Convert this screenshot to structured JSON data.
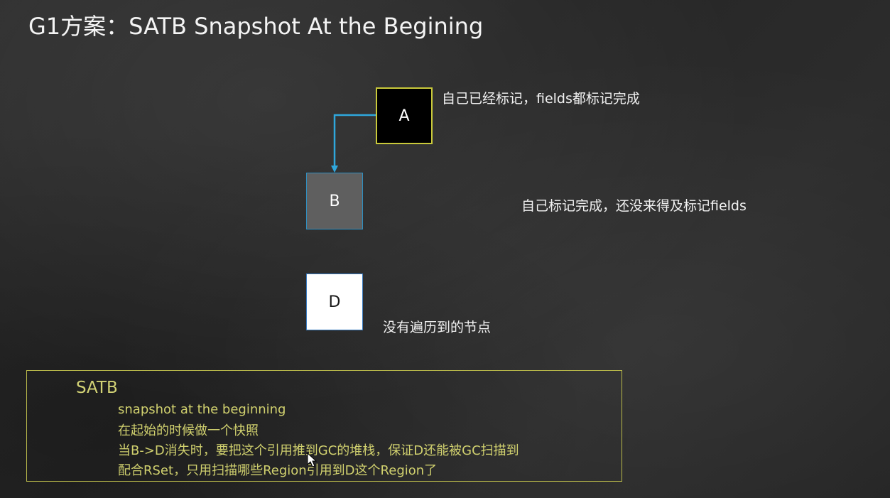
{
  "slide": {
    "title": "G1方案：SATB Snapshot At the Begining"
  },
  "nodes": {
    "a": {
      "letter": "A",
      "label": "自己已经标记，fields都标记完成"
    },
    "b": {
      "letter": "B",
      "label": "自己标记完成，还没来得及标记fields"
    },
    "d": {
      "letter": "D",
      "label": "没有遍历到的节点"
    }
  },
  "satb_box": {
    "heading": "SATB",
    "lines": [
      "snapshot at the beginning",
      "在起始的时候做一个快照",
      "当B->D消失时，要把这个引用推到GC的堆栈，保证D还能被GC扫描到",
      "配合RSet，只用扫描哪些Region引用到D这个Region了"
    ]
  },
  "colors": {
    "background": "#2b2b2b",
    "node_a_fill": "#000000",
    "node_a_border": "#c9c93a",
    "node_b_fill": "#5f5f5f",
    "node_d_fill": "#ffffff",
    "arrow": "#2fa7dc",
    "satb_text": "#d0d06e",
    "satb_border": "#b9b94a"
  },
  "icons": {
    "arrow": "arrow-a-to-b",
    "cursor": "mouse-pointer-icon"
  }
}
